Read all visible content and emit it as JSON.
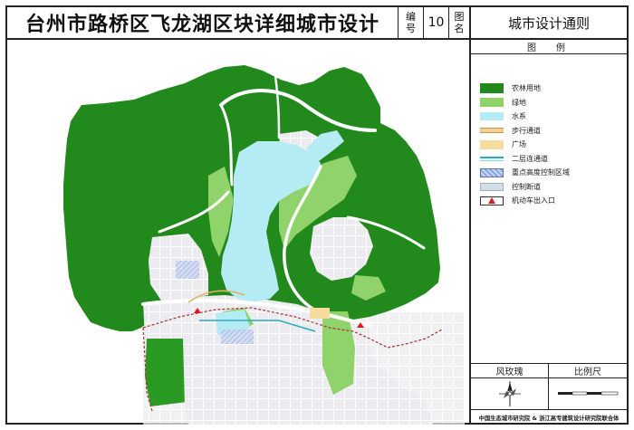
{
  "title": "台州市路桥区飞龙湖区块详细城市设计",
  "sheet_no_label_a": "编",
  "sheet_no_label_b": "号",
  "sheet_no": "10",
  "sheet_name_label_a": "图",
  "sheet_name_label_b": "名",
  "sheet_name": "城市设计通则",
  "legend": {
    "heading": "图　例",
    "items": [
      {
        "label": "农林用地",
        "color": "#22891c"
      },
      {
        "label": "绿地",
        "color": "#8fd36a"
      },
      {
        "label": "水系",
        "color": "#b5ecf4"
      },
      {
        "label": "步行通道",
        "color": "#f4ce90"
      },
      {
        "label": "广场",
        "color": "#f7dca0"
      },
      {
        "label": "二层连通道",
        "color": "#2aa9c4"
      },
      {
        "label": "重点高度控制区域",
        "color": "#8aa6da"
      },
      {
        "label": "控制断道",
        "color": "#d3dde6"
      },
      {
        "label": "机动车出入口",
        "color": "#d31f1f"
      }
    ]
  },
  "wind_rose_label": "风玫瑰",
  "scale_label": "比例尺",
  "credit": "中国生态城市研究院 & 浙江高专建筑设计研究院联合体",
  "colors": {
    "farmland": "#22891c",
    "greenland": "#8fd36a",
    "water": "#b5ecf4",
    "urban": "#ececf0",
    "road": "#ffffff",
    "boundary": "#b03030"
  }
}
